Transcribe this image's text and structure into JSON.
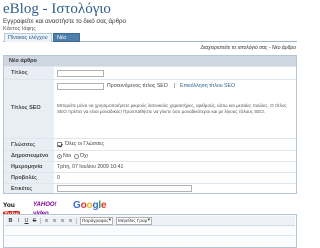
{
  "header": {
    "title": "eBlog - Ιστολόγιο",
    "subtitle": "Εγγραφείτε και αναστήστε το δικό σας άρθρο",
    "user": "Κάντος Ιάφης"
  },
  "tabs": [
    {
      "label": "Πίνακας ελέγχου"
    },
    {
      "label": "Νέο άρθρο"
    }
  ],
  "actions": {
    "manage": "Διαχειριστείτε το ιστολόγιό σας",
    "separator": " - ",
    "new_article": "Νέο άρθρο"
  },
  "form": {
    "section_title": "Νέο άρθρο",
    "title_label": "Τίτλος",
    "title_value": "",
    "seo_label": "Τίτλος SEO",
    "seo_value": "",
    "seo_hint": "Προτεινόμενος τίτλος SEO",
    "seo_sep": "|",
    "seo_link": "Επικόλληση τίτλου SEO",
    "seo_note": "Μπορείτε μόνο να χρησιμοποιήσετε μικρούς λατινικούς χαρακτήρες, αριθμούς, κάτω και μεσαίες παύλες. Ο τίτλος SEO πρέπει να είναι μοναδικός! Προσπαθήστε να γίνετε όσο μοναδικότεροι και με λίγους τίτλους SEO.",
    "language_label": "Γλώσσες",
    "language_option": "Όλες οι Γλώσσες",
    "status_label": "Δημοσιευμένο",
    "status_option_yes": "Ναι",
    "status_option_no": "Όχι",
    "date_label": "Ημερομηνία",
    "date_value": "Τρίτη, 07 Ιουλίου 2009 10:41",
    "views_label": "Προβολές",
    "views_value": "0",
    "tags_label": "Ετικέτες",
    "tags_value": ""
  },
  "media": {
    "youtube_you": "You",
    "youtube_tube": "Tube",
    "yahoo": "YAHOO! video",
    "google": [
      "G",
      "o",
      "o",
      "g",
      "l",
      "e"
    ]
  },
  "editor": {
    "bold": "B",
    "italic": "I",
    "underline": "U",
    "strike": "S",
    "format_select": "Παράγραφος",
    "size_select": "Μέγεθος Γραμ"
  }
}
